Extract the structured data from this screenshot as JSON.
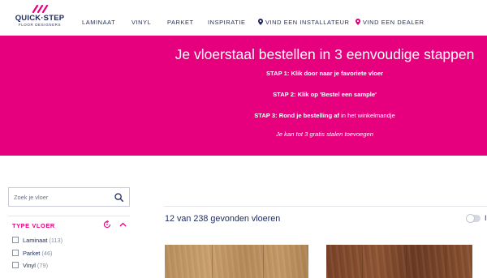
{
  "colors": {
    "brand_pink": "#e6007e",
    "navy": "#1e2b5e"
  },
  "logo": {
    "brand": "QUICK·STEP",
    "sub": "FLOOR DESIGNERS",
    "icon": "logo-stripes-icon"
  },
  "nav": {
    "items": [
      "LAMINAAT",
      "VINYL",
      "PARKET",
      "INSPIRATIE"
    ],
    "installer": {
      "label": "VIND EEN INSTALLATEUR",
      "icon": "location-pin-icon"
    },
    "dealer": {
      "label": "VIND EEN DEALER",
      "icon": "location-pin-icon"
    }
  },
  "hero": {
    "title": "Je vloerstaal bestellen in 3 eenvoudige stappen",
    "step1_bold": "STAP 1:",
    "step1_text": " Klik door naar je favoriete vloer",
    "step2_bold": "STAP 2:",
    "step2_text": " Klik op ",
    "step2_bold2": "'Bestel een sample'",
    "step3_bold": "STAP 3:",
    "step3_text": " Rond je bestelling af",
    "step3_tail": " in het winkelmandje",
    "note": "Je kan tot 3 gratis stalen toevoegen"
  },
  "sidebar": {
    "search_placeholder": "Zoek je vloer",
    "filter_title": "TYPE VLOER",
    "options": [
      {
        "label": "Laminaat",
        "count": "(113)"
      },
      {
        "label": "Parket",
        "count": "(46)"
      },
      {
        "label": "Vinyl",
        "count": "(79)"
      }
    ]
  },
  "results": {
    "count_text": "12 van 238 gevonden vloeren",
    "toggle_cut_label": "I"
  }
}
